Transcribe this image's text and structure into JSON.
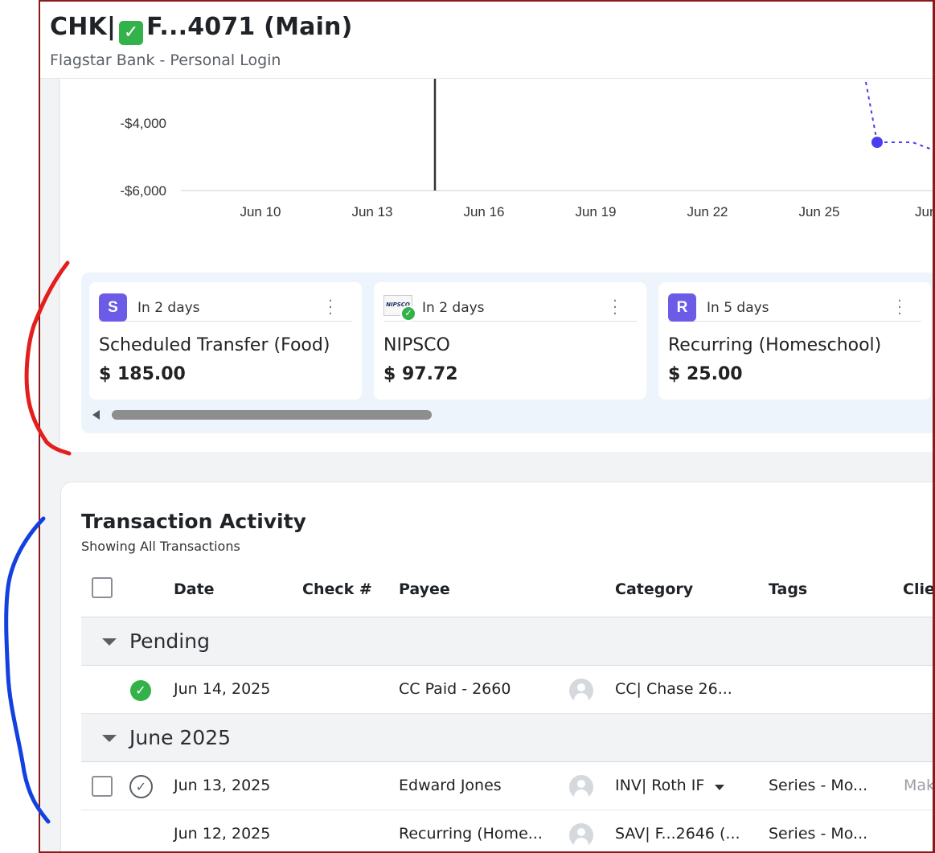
{
  "header": {
    "account_prefix": "CHK|",
    "account_suffix": "F...4071 (Main)",
    "check_icon": "white-check-mark-icon",
    "subtitle": "Flagstar Bank - Personal Login"
  },
  "chart_data": {
    "type": "line",
    "y_ticks": [
      "-$4,000",
      "-$6,000"
    ],
    "x_ticks": [
      "Jun 10",
      "Jun 13",
      "Jun 16",
      "Jun 19",
      "Jun 22",
      "Jun 25",
      "Jun"
    ],
    "today_marker": "Jun 15",
    "series": [
      {
        "style": "dashed-projection",
        "color": "#4a3df0",
        "points": [
          {
            "x": "Jun 27",
            "y": -4600
          }
        ]
      }
    ],
    "grid": false
  },
  "scheduled": {
    "cards": [
      {
        "badge": "S",
        "when": "In 2 days",
        "name": "Scheduled Transfer (Food)",
        "amount": "$ 185.00",
        "badge_color": "#6b5be6"
      },
      {
        "logo_text": "NIPSCO",
        "when": "In 2 days",
        "name": "NIPSCO",
        "amount": "$ 97.72"
      },
      {
        "badge": "R",
        "when": "In 5 days",
        "name": "Recurring (Homeschool)",
        "amount": "$ 25.00",
        "badge_color": "#6b5be6"
      }
    ]
  },
  "transactions": {
    "title": "Transaction Activity",
    "subtitle": "Showing All Transactions",
    "columns": [
      "Date",
      "Check #",
      "Payee",
      "Category",
      "Tags",
      "Clie"
    ],
    "groups": [
      {
        "label": "Pending"
      },
      {
        "label": "June 2025"
      }
    ],
    "rows": [
      {
        "date": "Jun 14, 2025",
        "payee": "CC Paid - 2660",
        "category": "CC| Chase 26...",
        "tags": "",
        "client": "",
        "status": "pending-approved"
      },
      {
        "date": "Jun 13, 2025",
        "payee": "Edward Jones",
        "category": "INV| Roth IF",
        "tags": "Series - Mo...",
        "client": "Mak",
        "status": "cleared"
      },
      {
        "date": "Jun 12, 2025",
        "payee": "Recurring (Home...",
        "category": "SAV| F...2646 (...",
        "tags": "Series - Mo...",
        "client": "",
        "status": "none"
      }
    ]
  }
}
